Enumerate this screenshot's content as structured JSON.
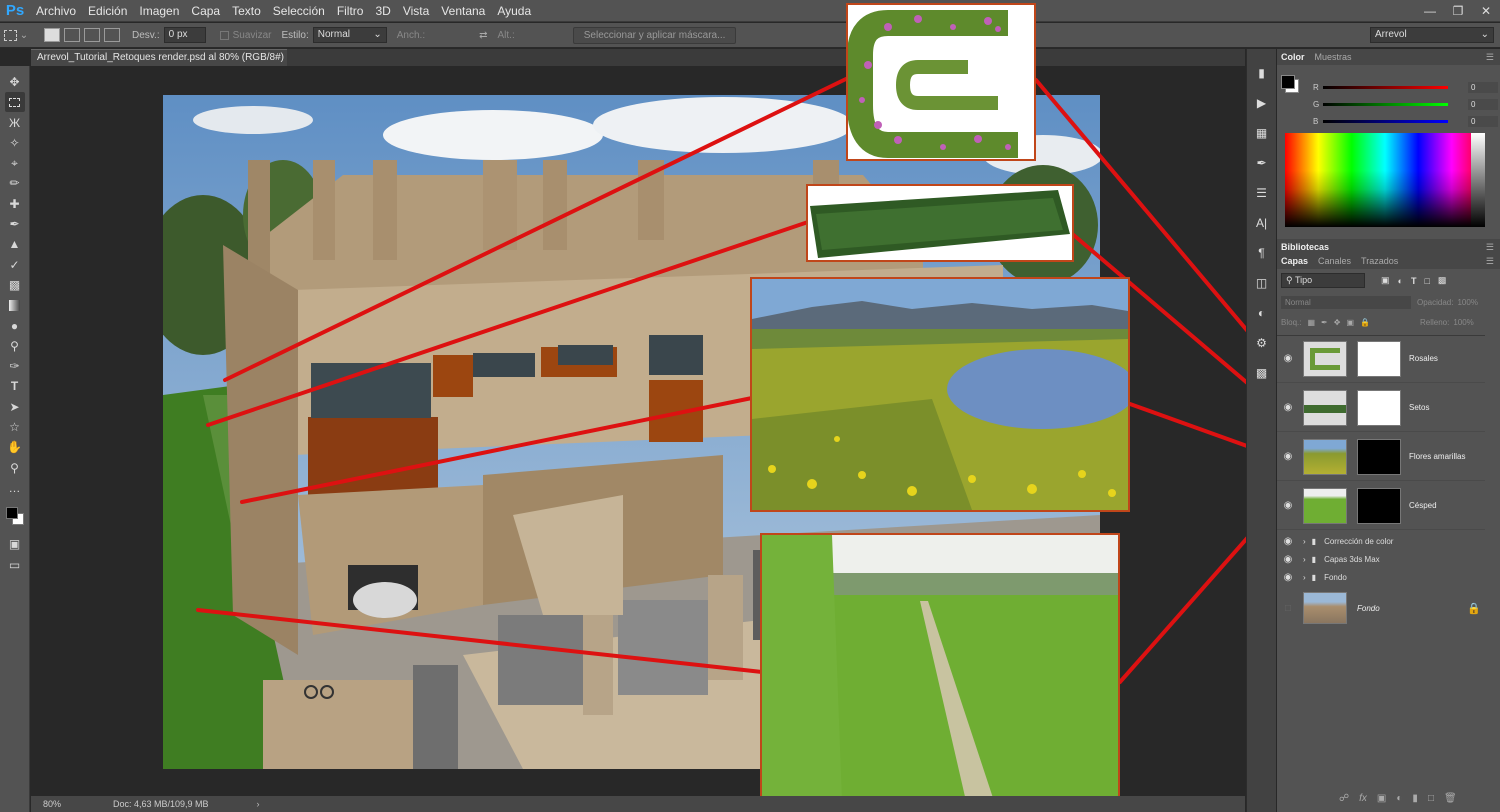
{
  "app": {
    "logo": "Ps"
  },
  "menu": [
    "Archivo",
    "Edición",
    "Imagen",
    "Capa",
    "Texto",
    "Selección",
    "Filtro",
    "3D",
    "Vista",
    "Ventana",
    "Ayuda"
  ],
  "options": {
    "feather_label": "Desv.:",
    "feather_value": "0 px",
    "antialias_label": "Suavizar",
    "style_label": "Estilo:",
    "style_value": "Normal",
    "width_label": "Anch.:",
    "height_label": "Alt.:",
    "mask_button": "Seleccionar y aplicar máscara...",
    "workspace": "Arrevol"
  },
  "document": {
    "tab_title": "Arrevol_Tutorial_Retoques render.psd al 80% (RGB/8#) *",
    "zoom": "80%",
    "doc_info": "Doc: 4,63 MB/109,9 MB"
  },
  "color_panel": {
    "tabs": [
      "Color",
      "Muestras"
    ],
    "channels": [
      {
        "label": "R",
        "value": "0"
      },
      {
        "label": "G",
        "value": "0"
      },
      {
        "label": "B",
        "value": "0"
      }
    ]
  },
  "libraries_label": "Bibliotecas",
  "layers_panel": {
    "tabs": [
      "Capas",
      "Canales",
      "Trazados"
    ],
    "filter": "Tipo",
    "blend_mode": "Normal",
    "opacity_label": "Opacidad:",
    "opacity_value": "100%",
    "lock_label": "Bloq.:",
    "fill_label": "Relleno:",
    "fill_value": "100%",
    "layers": [
      {
        "name": "Rosales"
      },
      {
        "name": "Setos"
      },
      {
        "name": "Flores amarillas"
      },
      {
        "name": "Césped"
      }
    ],
    "groups": [
      "Corrección de color",
      "Capas 3ds Max",
      "Fondo"
    ],
    "background": "Fondo"
  },
  "colors": {
    "accent": "#31a8ff",
    "callout_line": "#dd1111",
    "callout_border": "#c0461a"
  },
  "icons": {
    "tools": [
      "move-icon",
      "marquee-icon",
      "lasso-icon",
      "magic-wand-icon",
      "crop-icon",
      "eyedropper-icon",
      "healing-icon",
      "brush-icon",
      "stamp-icon",
      "history-brush-icon",
      "eraser-icon",
      "gradient-icon",
      "blur-icon",
      "dodge-icon",
      "pen-icon",
      "type-icon",
      "path-select-icon",
      "shape-icon",
      "hand-icon",
      "zoom-icon",
      "more-icon"
    ]
  }
}
